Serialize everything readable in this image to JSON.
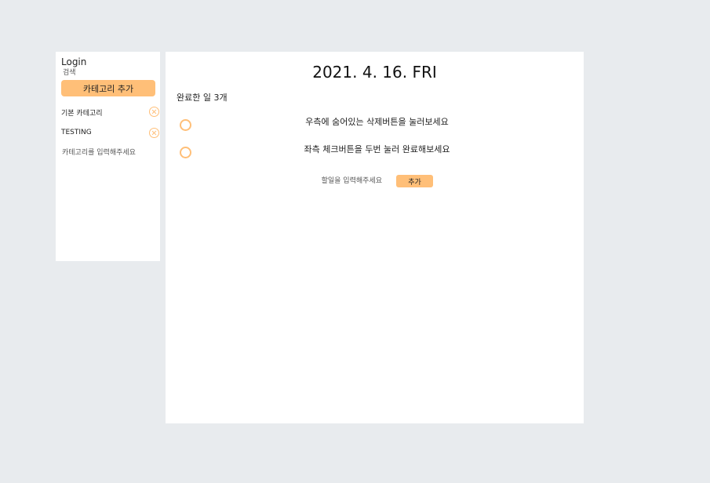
{
  "sidebar": {
    "login_label": "Login",
    "search_label": "검색",
    "add_category_label": "카테고리 추가",
    "categories": [
      {
        "label": "기본 카테고리"
      },
      {
        "label": "TESTING"
      }
    ],
    "category_input_placeholder": "카테고리를 입력해주세요",
    "category_input_value": ""
  },
  "main": {
    "date_title": "2021. 4. 16. FRI",
    "done_count": "완료한 일 3개",
    "todos": [
      {
        "text": "우측에 숨어있는 삭제버튼을 눌러보세요",
        "completed": false
      },
      {
        "text": "좌측 체크버튼을 두번 눌러 완료해보세요",
        "completed": false
      }
    ],
    "todo_input_placeholder": "할일을 입력해주세요",
    "todo_input_value": "",
    "add_todo_label": "추가"
  },
  "colors": {
    "accent": "#ffbf78",
    "page_background": "#e8ebee",
    "panel_background": "#ffffff"
  },
  "icons": {
    "category_delete": "close-circle-icon",
    "todo_check": "check-circle-icon"
  }
}
